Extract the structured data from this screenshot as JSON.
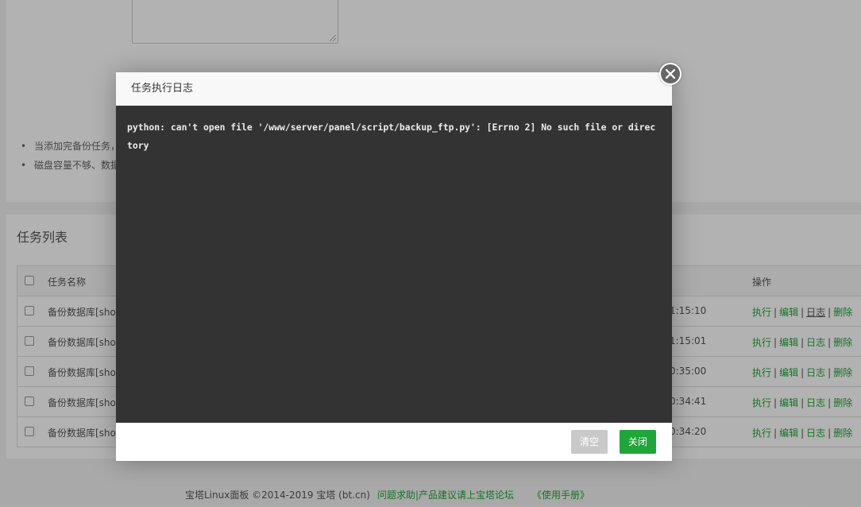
{
  "tips": [
    "当添加完备份任务，",
    "磁盘容量不够、数据"
  ],
  "task_list": {
    "title": "任务列表",
    "header": {
      "name": "任务名称",
      "ops": "操作"
    },
    "rows": [
      {
        "name": "备份数据库[shop",
        "time": "1:15:10",
        "log_active": true
      },
      {
        "name": "备份数据库[shop",
        "time": "1:15:01",
        "log_active": false
      },
      {
        "name": "备份数据库[shop",
        "time": "0:35:00",
        "log_active": false
      },
      {
        "name": "备份数据库[shop",
        "time": "0:34:41",
        "log_active": false
      },
      {
        "name": "备份数据库[shop",
        "time": "0:34:20",
        "log_active": false
      }
    ],
    "ops": {
      "run": "执行",
      "edit": "编辑",
      "log": "日志",
      "delete": "删除",
      "sep": "|"
    }
  },
  "footer": {
    "copyright": "宝塔Linux面板 ©2014-2019 宝塔 (bt.cn)",
    "help_link": "问题求助|产品建议请上宝塔论坛",
    "manual_link": "《使用手册》"
  },
  "modal": {
    "title": "任务执行日志",
    "log_text": "python: can't open file '/www/server/panel/script/backup_ftp.py': [Errno 2] No such file or directory",
    "clear_label": "清空",
    "close_label": "关闭"
  },
  "colors": {
    "accent": "#20a53a",
    "console_bg": "#333333"
  }
}
